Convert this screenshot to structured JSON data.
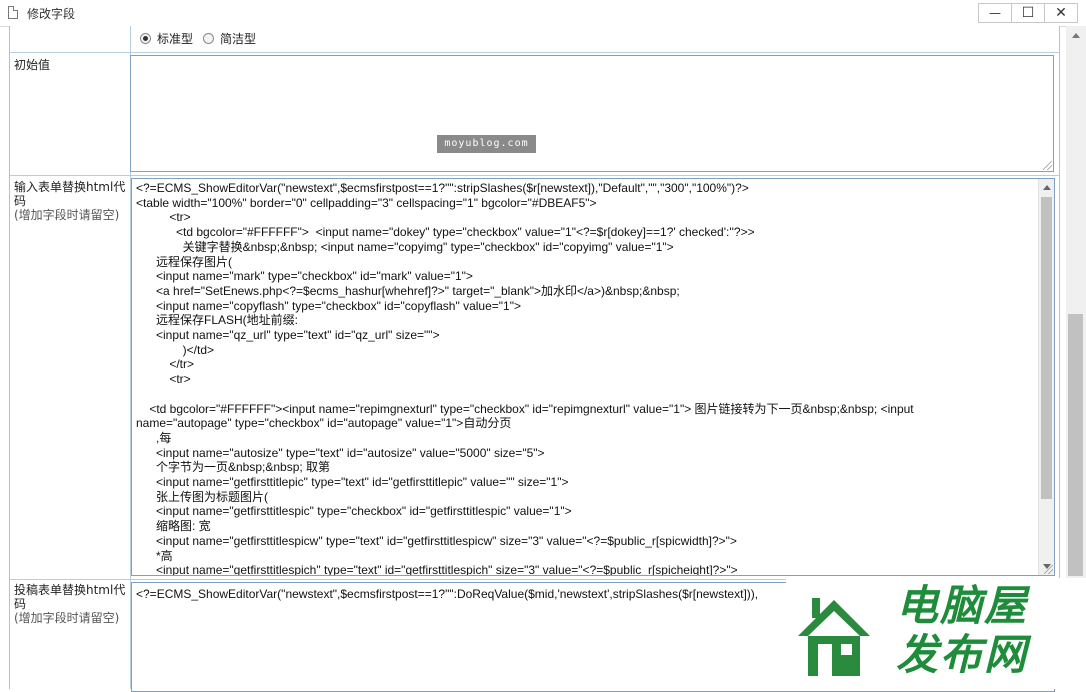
{
  "window": {
    "title": "修改字段",
    "buttons": {
      "minimize": "—",
      "maximize": "☐",
      "close": "✕"
    }
  },
  "editor_type": {
    "options": [
      {
        "label": "标准型",
        "checked": true
      },
      {
        "label": "简洁型",
        "checked": false
      }
    ]
  },
  "initial_value": {
    "label": "初始值",
    "value": "",
    "watermark": "moyublog.com"
  },
  "input_form_html": {
    "label": "输入表单替换html代码",
    "note": "(增加字段时请留空)",
    "code": "<?=ECMS_ShowEditorVar(\"newstext\",$ecmsfirstpost==1?\"\":stripSlashes($r[newstext]),\"Default\",\"\",\"300\",\"100%\")?>\n<table width=\"100%\" border=\"0\" cellpadding=\"3\" cellspacing=\"1\" bgcolor=\"#DBEAF5\">\n          <tr>\n            <td bgcolor=\"#FFFFFF\">  <input name=\"dokey\" type=\"checkbox\" value=\"1\"<?=$r[dokey]==1?' checked':''?>>\n              关键字替换&nbsp;&nbsp; <input name=\"copyimg\" type=\"checkbox\" id=\"copyimg\" value=\"1\">\n      远程保存图片(\n      <input name=\"mark\" type=\"checkbox\" id=\"mark\" value=\"1\">\n      <a href=\"SetEnews.php<?=$ecms_hashur[whehref]?>\" target=\"_blank\">加水印</a>)&nbsp;&nbsp;\n      <input name=\"copyflash\" type=\"checkbox\" id=\"copyflash\" value=\"1\">\n      远程保存FLASH(地址前缀:\n      <input name=\"qz_url\" type=\"text\" id=\"qz_url\" size=\"\">\n              )</td>\n          </tr>\n          <tr>\n\n    <td bgcolor=\"#FFFFFF\"><input name=\"repimgnexturl\" type=\"checkbox\" id=\"repimgnexturl\" value=\"1\"> 图片链接转为下一页&nbsp;&nbsp; <input\nname=\"autopage\" type=\"checkbox\" id=\"autopage\" value=\"1\">自动分页\n      ,每\n      <input name=\"autosize\" type=\"text\" id=\"autosize\" value=\"5000\" size=\"5\">\n      个字节为一页&nbsp;&nbsp; 取第\n      <input name=\"getfirsttitlepic\" type=\"text\" id=\"getfirsttitlepic\" value=\"\" size=\"1\">\n      张上传图为标题图片(\n      <input name=\"getfirsttitlespic\" type=\"checkbox\" id=\"getfirsttitlespic\" value=\"1\">\n      缩略图: 宽\n      <input name=\"getfirsttitlespicw\" type=\"text\" id=\"getfirsttitlespicw\" size=\"3\" value=\"<?=$public_r[spicwidth]?>\">\n      *高\n      <input name=\"getfirsttitlespich\" type=\"text\" id=\"getfirsttitlespich\" size=\"3\" value=\"<?=$public_r[spicheight]?>\">\n      )</td>"
  },
  "submit_form_html": {
    "label": "投稿表单替换html代码",
    "note": "(增加字段时请留空)",
    "code": "<?=ECMS_ShowEditorVar(\"newstext\",$ecmsfirstpost==1?\"\":DoReqValue($mid,'newstext',stripSlashes($r[newstext])),"
  },
  "logo": {
    "line1": "电脑屋",
    "line2": "发布网",
    "colors": {
      "green": "#1e8c3a",
      "house": "#2a8a3e"
    }
  }
}
